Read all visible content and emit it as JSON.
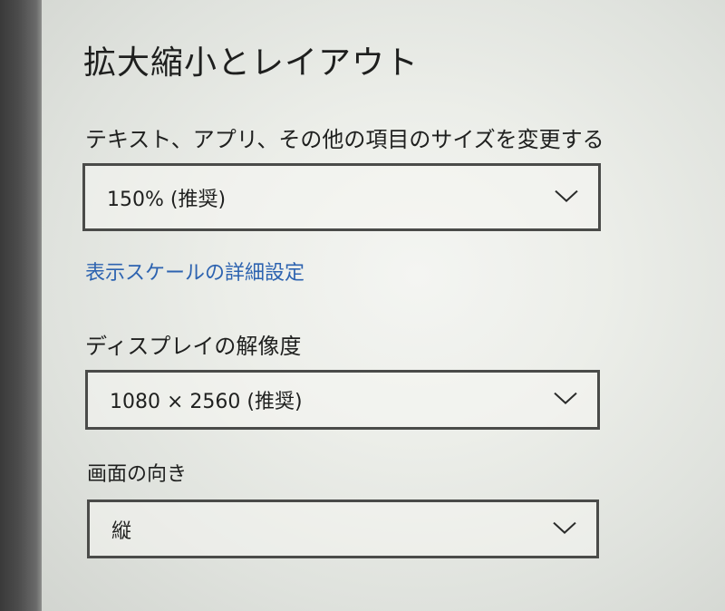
{
  "section": {
    "title": "拡大縮小とレイアウト"
  },
  "scale": {
    "label": "テキスト、アプリ、その他の項目のサイズを変更する",
    "value": "150% (推奨)",
    "chevron_icon": "chevron-down-icon"
  },
  "advanced_link": {
    "label": "表示スケールの詳細設定",
    "color": "#2d63b0"
  },
  "resolution": {
    "label": "ディスプレイの解像度",
    "value": "1080 × 2560 (推奨)",
    "chevron_icon": "chevron-down-icon"
  },
  "orientation": {
    "label": "画面の向き",
    "value": "縦",
    "chevron_icon": "chevron-down-icon"
  }
}
